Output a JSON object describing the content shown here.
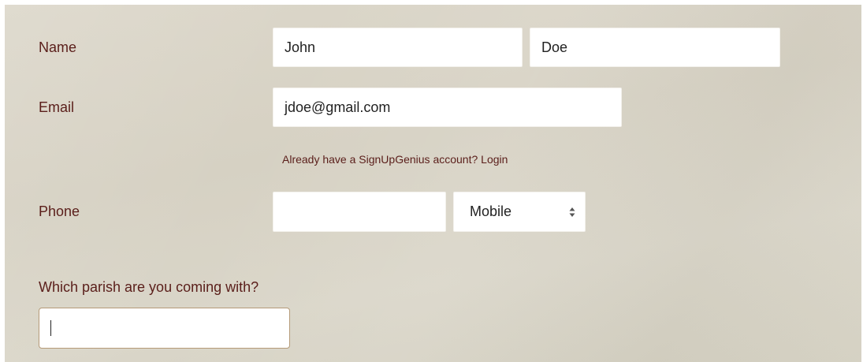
{
  "form": {
    "name": {
      "label": "Name",
      "first_value": "John",
      "last_value": "Doe"
    },
    "email": {
      "label": "Email",
      "value": "jdoe@gmail.com",
      "account_prompt": "Already have a SignUpGenius account?",
      "login_link": "Login"
    },
    "phone": {
      "label": "Phone",
      "value": "",
      "type_selected": "Mobile"
    },
    "parish": {
      "question": "Which parish are you coming with?",
      "value": ""
    }
  },
  "colors": {
    "label_text": "#5a1e1a",
    "panel_bg": "#d9d4c6",
    "field_bg": "#ffffff"
  }
}
